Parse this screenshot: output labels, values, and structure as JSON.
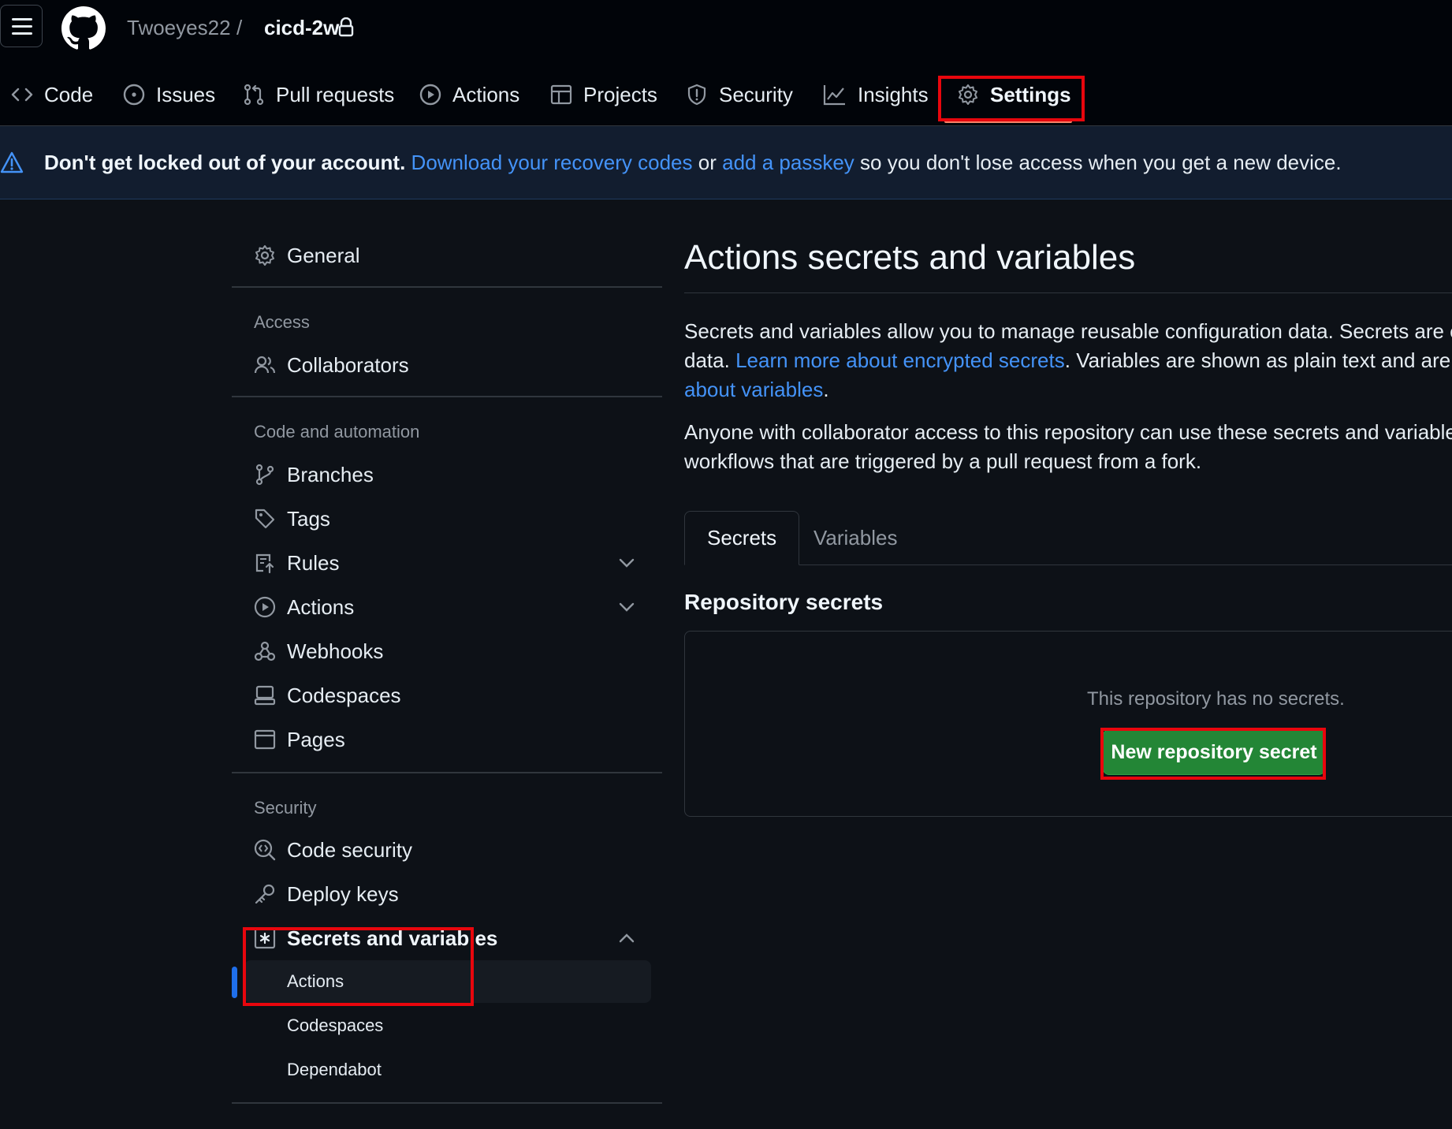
{
  "header": {
    "owner": "Twoeyes22",
    "separator": "/",
    "repo": "cicd-2w",
    "icons": [
      "menu-icon",
      "github-logo",
      "lock-icon"
    ]
  },
  "nav": {
    "tabs": [
      {
        "label": "Code",
        "icon": "code-icon"
      },
      {
        "label": "Issues",
        "icon": "issue-opened-icon"
      },
      {
        "label": "Pull requests",
        "icon": "git-pull-request-icon"
      },
      {
        "label": "Actions",
        "icon": "play-icon"
      },
      {
        "label": "Projects",
        "icon": "table-icon"
      },
      {
        "label": "Security",
        "icon": "shield-icon"
      },
      {
        "label": "Insights",
        "icon": "graph-icon"
      },
      {
        "label": "Settings",
        "icon": "gear-icon",
        "selected": true
      }
    ]
  },
  "banner": {
    "bold": "Don't get locked out of your account.",
    "link1": "Download your recovery codes",
    "or": "or",
    "link2": "add a passkey",
    "rest": "so you don't lose access when you get a new device."
  },
  "sidebar": {
    "general": "General",
    "access_heading": "Access",
    "collaborators": "Collaborators",
    "code_heading": "Code and automation",
    "branches": "Branches",
    "tags": "Tags",
    "rules": "Rules",
    "actions": "Actions",
    "webhooks": "Webhooks",
    "codespaces": "Codespaces",
    "pages": "Pages",
    "security_heading": "Security",
    "code_security": "Code security",
    "deploy_keys": "Deploy keys",
    "secrets_variables": "Secrets and variables",
    "sub_actions": "Actions",
    "sub_codespaces": "Codespaces",
    "sub_dependabot": "Dependabot"
  },
  "main": {
    "title": "Actions secrets and variables",
    "p1_l1_a": "Secrets and variables allow you to manage reusable configuration data. Secrets are ",
    "p1_l1_b": "encryp",
    "p1_l2_a": "data. ",
    "p1_l2_link": "Learn more about encrypted secrets",
    "p1_l2_b": ". Variables are shown as plain text and are used f",
    "p1_l3_link": "about variables",
    "p1_l3_b": ".",
    "p2_l1": "Anyone with collaborator access to this repository can use these secrets and variables for a",
    "p2_l2": "workflows that are triggered by a pull request from a fork.",
    "tab_secrets": "Secrets",
    "tab_variables": "Variables",
    "repo_secrets_heading": "Repository secrets",
    "empty_text": "This repository has no secrets.",
    "new_button": "New repository secret"
  },
  "colors": {
    "background": "#0d1117",
    "header": "#010409",
    "accent_link": "#4493f8",
    "button_green": "#238636",
    "annotation_red": "#e8060d",
    "active_bar": "#1f6feb"
  }
}
